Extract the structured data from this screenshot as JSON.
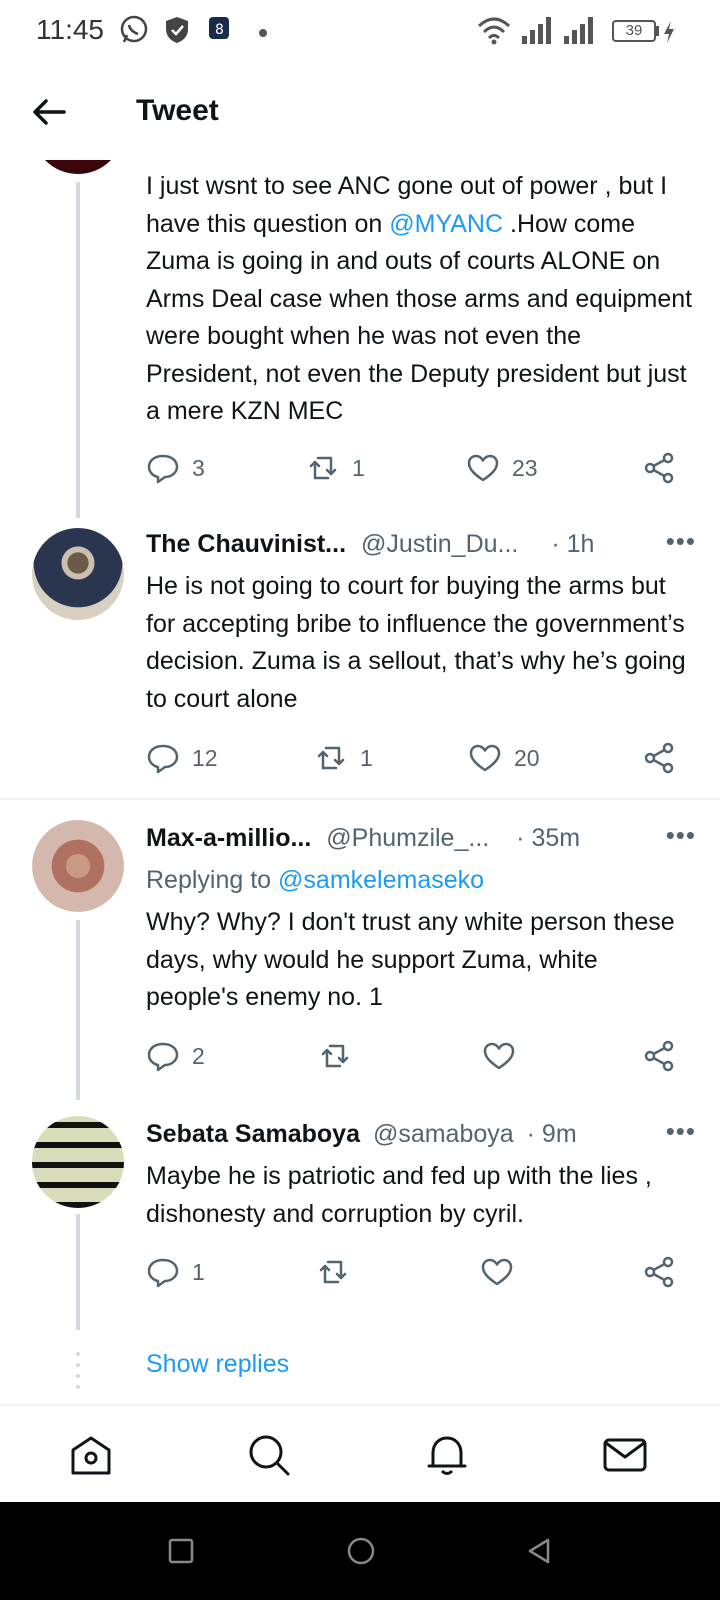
{
  "status_bar": {
    "time": "11:45",
    "battery": "39"
  },
  "header": {
    "title": "Tweet"
  },
  "tweets": [
    {
      "text_parts": [
        "I just wsnt to see ANC gone out of power , but I have this question on ",
        "@MYANC",
        " .How come Zuma is going in and outs of courts ALONE on Arms Deal case when those arms and equipment were bought when he was not even the President,  not even the Deputy president but just a mere KZN MEC"
      ],
      "replies": "3",
      "retweets": "1",
      "likes": "23"
    },
    {
      "name": "The Chauvinist...",
      "handle": "@Justin_Du...",
      "time": "· 1h",
      "text": "He is not going to court for buying the arms but for accepting bribe to influence the government’s decision. Zuma is a sellout, that’s why he’s going to court alone",
      "replies": "12",
      "retweets": "1",
      "likes": "20"
    },
    {
      "name": "Max-a-millio...",
      "handle": "@Phumzile_...",
      "time": "· 35m",
      "replying_label": "Replying to",
      "replying_handle": "@samkelemaseko",
      "text": "Why?  Why?  I don't trust any white person these days, why would he support Zuma, white people's enemy no. 1",
      "replies": "2",
      "retweets": "",
      "likes": ""
    },
    {
      "name": "Sebata Samaboya",
      "handle": "@samaboya",
      "time": "· 9m",
      "text": "Maybe he is patriotic and fed up with the lies , dishonesty and corruption by cyril.",
      "replies": "1",
      "retweets": "",
      "likes": ""
    }
  ],
  "show_replies": "Show replies",
  "tabs": [
    "home-icon",
    "search-icon",
    "notifications-icon",
    "messages-icon"
  ],
  "colors": {
    "accent": "#1d9bf0",
    "secondary_text": "#536471",
    "thread_line": "#cfd9de"
  }
}
